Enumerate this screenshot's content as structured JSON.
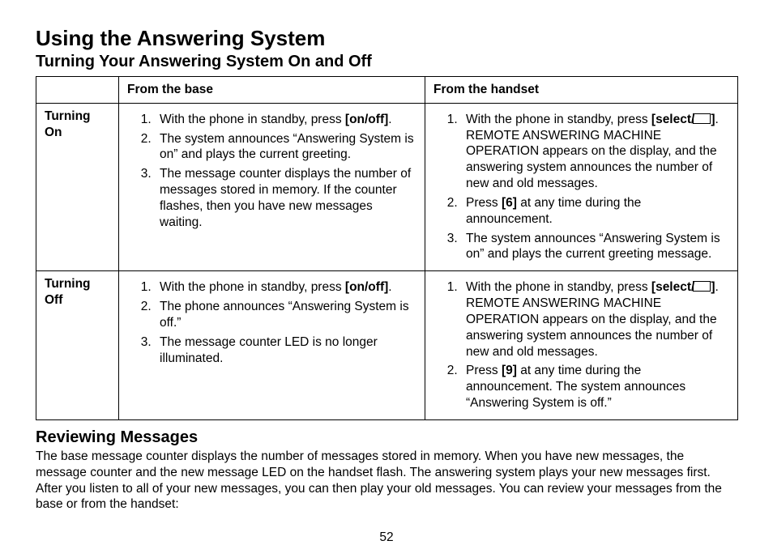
{
  "page_number": "52",
  "heading": "Using the Answering System",
  "subheading1": "Turning Your Answering System On and Off",
  "table": {
    "col1": "From the base",
    "col2": "From the handset",
    "rows": [
      {
        "label": "Turning On",
        "base": [
          {
            "pre": "With the phone in standby, press ",
            "bold": "[on/off]",
            "post": "."
          },
          {
            "text": "The system announces “Answering System is on” and plays the current greeting."
          },
          {
            "text": "The message counter displays the number of messages stored in memory. If the counter flashes, then you have new messages waiting."
          }
        ],
        "handset": [
          {
            "pre": "With the phone in standby, press ",
            "bold": "[select/",
            "icon": "answer-machine-icon",
            "bold2": "]",
            "post": ". REMOTE ANSWERING MACHINE OPERATION appears on the display, and the answering system announces the number of new and old messages."
          },
          {
            "pre": "Press ",
            "bold": "[6]",
            "post": " at any time during the announcement."
          },
          {
            "text": "The system announces “Answering System is on” and plays the current greeting message."
          }
        ]
      },
      {
        "label": "Turning Off",
        "base": [
          {
            "pre": "With the phone in standby, press ",
            "bold": "[on/off]",
            "post": "."
          },
          {
            "text": "The phone announces “Answering System is off.”"
          },
          {
            "text": "The message counter LED is no longer illuminated."
          }
        ],
        "handset": [
          {
            "pre": "With the phone in standby, press ",
            "bold": "[select/",
            "icon": "answer-machine-icon",
            "bold2": "]",
            "post": ". REMOTE ANSWERING MACHINE OPERATION appears on the display, and the answering system announces the number of new and old messages."
          },
          {
            "pre": "Press ",
            "bold": "[9]",
            "post": " at any time during the announcement. The system announces “Answering System is off.”"
          }
        ]
      }
    ]
  },
  "subheading2": "Reviewing Messages",
  "paragraph": "The base message counter displays the number of messages stored in memory. When you have new messages, the message counter and the new message LED on the handset flash. The answering system plays your new messages first. After you listen to all of your new messages, you can then play your old messages. You can review your messages from the base or from the handset:"
}
